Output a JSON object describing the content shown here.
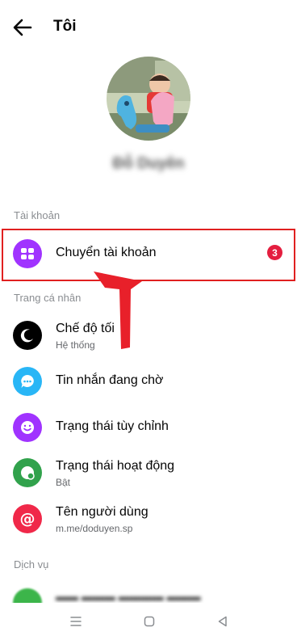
{
  "header": {
    "title": "Tôi"
  },
  "profile": {
    "name": "Đỗ Duyên"
  },
  "sections": {
    "account": "Tài khoản",
    "profile": "Trang cá nhân",
    "services": "Dịch vụ"
  },
  "account_items": [
    {
      "label": "Chuyển tài khoản",
      "badge": "3",
      "icon": "switch-account-icon",
      "color": "#a033ff"
    }
  ],
  "profile_items": [
    {
      "label": "Chế độ tối",
      "sub": "Hệ thống",
      "icon": "moon-icon",
      "color": "#000000"
    },
    {
      "label": "Tin nhắn đang chờ",
      "icon": "chat-bubble-icon",
      "color": "#29b6f6"
    },
    {
      "label": "Trạng thái tùy chỉnh",
      "icon": "smiley-icon",
      "color": "#a033ff"
    },
    {
      "label": "Trạng thái hoạt động",
      "sub": "Bật",
      "icon": "active-status-icon",
      "color": "#31a24c"
    },
    {
      "label": "Tên người dùng",
      "sub": "m.me/doduyen.sp",
      "icon": "at-sign-icon",
      "color": "#f02849"
    }
  ],
  "annotation": {
    "highlight_color": "#e02020",
    "arrow_color": "#e8202a"
  }
}
